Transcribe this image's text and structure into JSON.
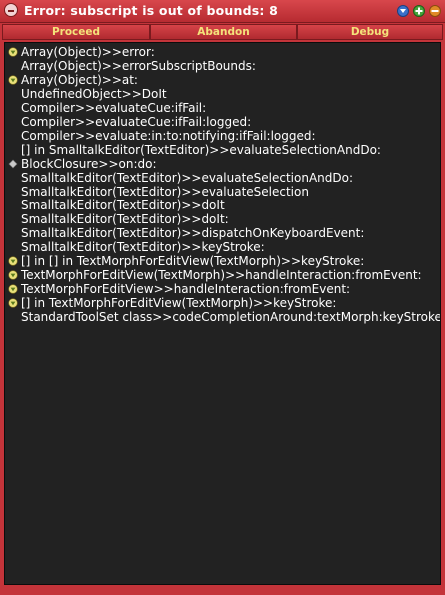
{
  "window": {
    "title": "Error: subscript is out of bounds: 8"
  },
  "buttons": {
    "proceed": "Proceed",
    "abandon": "Abandon",
    "debug": "Debug"
  },
  "colors": {
    "title_bar": "#c4343a",
    "button_text": "#f4e27a",
    "list_background": "#222222",
    "list_text": "#ffffff"
  },
  "stack": [
    {
      "text": "Array(Object)>>error:",
      "icon": "warning-icon"
    },
    {
      "text": "Array(Object)>>errorSubscriptBounds:",
      "icon": ""
    },
    {
      "text": "Array(Object)>>at:",
      "icon": "warning-icon"
    },
    {
      "text": "UndefinedObject>>DoIt",
      "icon": ""
    },
    {
      "text": "Compiler>>evaluateCue:ifFail:",
      "icon": ""
    },
    {
      "text": "Compiler>>evaluateCue:ifFail:logged:",
      "icon": ""
    },
    {
      "text": "Compiler>>evaluate:in:to:notifying:ifFail:logged:",
      "icon": ""
    },
    {
      "text": "[] in SmalltalkEditor(TextEditor)>>evaluateSelectionAndDo:",
      "icon": ""
    },
    {
      "text": "BlockClosure>>on:do:",
      "icon": "diamond-icon"
    },
    {
      "text": "SmalltalkEditor(TextEditor)>>evaluateSelectionAndDo:",
      "icon": ""
    },
    {
      "text": "SmalltalkEditor(TextEditor)>>evaluateSelection",
      "icon": ""
    },
    {
      "text": "SmalltalkEditor(TextEditor)>>doIt",
      "icon": ""
    },
    {
      "text": "SmalltalkEditor(TextEditor)>>doIt:",
      "icon": ""
    },
    {
      "text": "SmalltalkEditor(TextEditor)>>dispatchOnKeyboardEvent:",
      "icon": ""
    },
    {
      "text": "SmalltalkEditor(TextEditor)>>keyStroke:",
      "icon": ""
    },
    {
      "text": "[] in [] in TextMorphForEditView(TextMorph)>>keyStroke:",
      "icon": "warning-icon"
    },
    {
      "text": "TextMorphForEditView(TextMorph)>>handleInteraction:fromEvent:",
      "icon": "warning-icon"
    },
    {
      "text": "TextMorphForEditView>>handleInteraction:fromEvent:",
      "icon": "warning-icon"
    },
    {
      "text": "[] in TextMorphForEditView(TextMorph)>>keyStroke:",
      "icon": "warning-icon"
    },
    {
      "text": "StandardToolSet class>>codeCompletionAround:textMorph:keyStroke:",
      "icon": ""
    }
  ]
}
